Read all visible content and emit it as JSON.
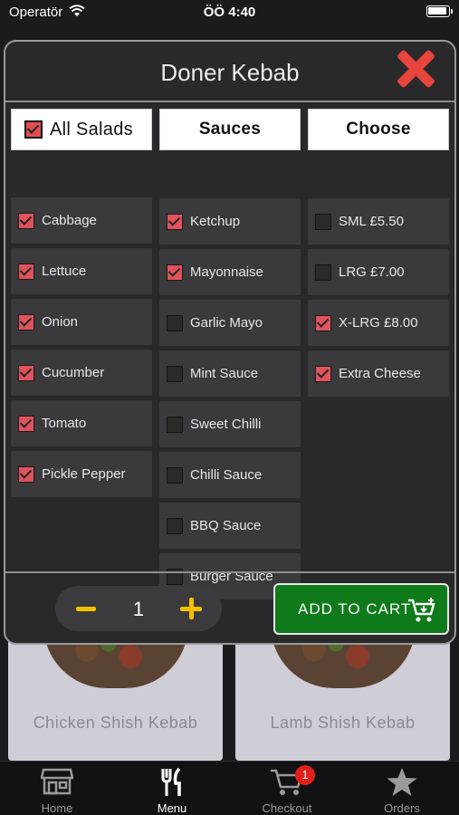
{
  "status_bar": {
    "carrier": "Operatör",
    "time": "ÖÖ 4:40"
  },
  "background_cards": [
    {
      "label": "Chicken Shish Kebab"
    },
    {
      "label": "Lamb Shish Kebab"
    }
  ],
  "modal": {
    "title": "Doner Kebab",
    "columns": [
      {
        "header": "All Salads",
        "header_checked": true,
        "items": [
          {
            "label": "Cabbage",
            "checked": true
          },
          {
            "label": "Lettuce",
            "checked": true
          },
          {
            "label": "Onion",
            "checked": true
          },
          {
            "label": "Cucumber",
            "checked": true
          },
          {
            "label": "Tomato",
            "checked": true
          },
          {
            "label": "Pickle Pepper",
            "checked": true
          }
        ]
      },
      {
        "header": "Sauces",
        "items": [
          {
            "label": "Ketchup",
            "checked": true
          },
          {
            "label": "Mayonnaise",
            "checked": true
          },
          {
            "label": "Garlic Mayo",
            "checked": false
          },
          {
            "label": "Mint Sauce",
            "checked": false
          },
          {
            "label": "Sweet Chilli",
            "checked": false
          },
          {
            "label": "Chilli Sauce",
            "checked": false
          },
          {
            "label": "BBQ Sauce",
            "checked": false
          },
          {
            "label": "Burger Sauce",
            "checked": false
          }
        ]
      },
      {
        "header": "Choose",
        "items": [
          {
            "label": "SML £5.50",
            "checked": false
          },
          {
            "label": "LRG £7.00",
            "checked": false
          },
          {
            "label": "X-LRG £8.00",
            "checked": true
          },
          {
            "label": "Extra Cheese",
            "checked": true
          }
        ]
      }
    ],
    "quantity": "1",
    "add_to_cart_label": "ADD TO CART"
  },
  "tab_bar": {
    "tabs": [
      {
        "label": "Home",
        "icon": "store-icon"
      },
      {
        "label": "Menu",
        "icon": "fork-knife-icon",
        "active": true
      },
      {
        "label": "Checkout",
        "icon": "cart-icon",
        "badge": "1"
      },
      {
        "label": "Orders",
        "icon": "star-icon"
      }
    ]
  },
  "colors": {
    "accent_red": "#e0535c",
    "add_button_green": "#0f7a1a",
    "stepper_yellow": "#f5c000",
    "badge_red": "#e0201a"
  }
}
